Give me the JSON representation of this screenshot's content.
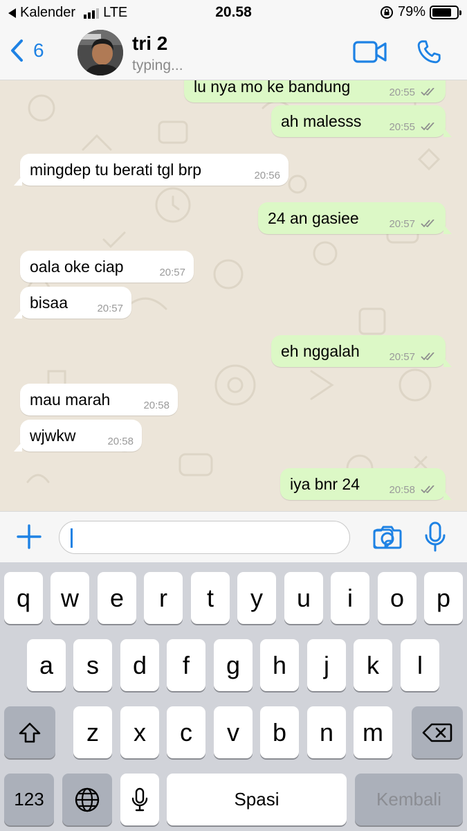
{
  "status_bar": {
    "back_app": "Kalender",
    "network": "LTE",
    "time": "20.58",
    "battery": "79%",
    "battery_level": 0.79
  },
  "header": {
    "back_count": "6",
    "contact_name": "tri 2",
    "contact_status": "typing..."
  },
  "messages": [
    {
      "text": "lu nya mo ke bandung",
      "time": "20:55",
      "direction": "out"
    },
    {
      "text": "ah malesss",
      "time": "20:55",
      "direction": "out"
    },
    {
      "text": "mingdep tu berati tgl brp",
      "time": "20:56",
      "direction": "in"
    },
    {
      "text": "24 an gasiee",
      "time": "20:57",
      "direction": "out"
    },
    {
      "text": "oala oke ciap",
      "time": "20:57",
      "direction": "in"
    },
    {
      "text": "bisaa",
      "time": "20:57",
      "direction": "in"
    },
    {
      "text": "eh nggalah",
      "time": "20:57",
      "direction": "out"
    },
    {
      "text": "mau marah",
      "time": "20:58",
      "direction": "in"
    },
    {
      "text": "wjwkw",
      "time": "20:58",
      "direction": "in"
    },
    {
      "text": "iya bnr 24",
      "time": "20:58",
      "direction": "out"
    }
  ],
  "input": {
    "value": ""
  },
  "keyboard": {
    "row1": [
      "q",
      "w",
      "e",
      "r",
      "t",
      "y",
      "u",
      "i",
      "o",
      "p"
    ],
    "row2": [
      "a",
      "s",
      "d",
      "f",
      "g",
      "h",
      "j",
      "k",
      "l"
    ],
    "row3": [
      "z",
      "x",
      "c",
      "v",
      "b",
      "n",
      "m"
    ],
    "numbers_label": "123",
    "space_label": "Spasi",
    "return_label": "Kembali"
  },
  "colors": {
    "accent": "#1e82e4",
    "outgoing_bubble": "#dcf8c6",
    "incoming_bubble": "#ffffff",
    "chat_background": "#ece5d9",
    "read_ticks": "#8e8e8e"
  },
  "icons": {
    "back": "chevron-left-icon",
    "video": "video-camera-icon",
    "call": "phone-icon",
    "attach": "plus-icon",
    "sticker": "sticker-icon",
    "camera": "camera-icon",
    "mic": "microphone-icon",
    "shift": "shift-icon",
    "delete": "backspace-icon",
    "globe": "globe-icon",
    "dictation": "dictation-mic-icon"
  }
}
